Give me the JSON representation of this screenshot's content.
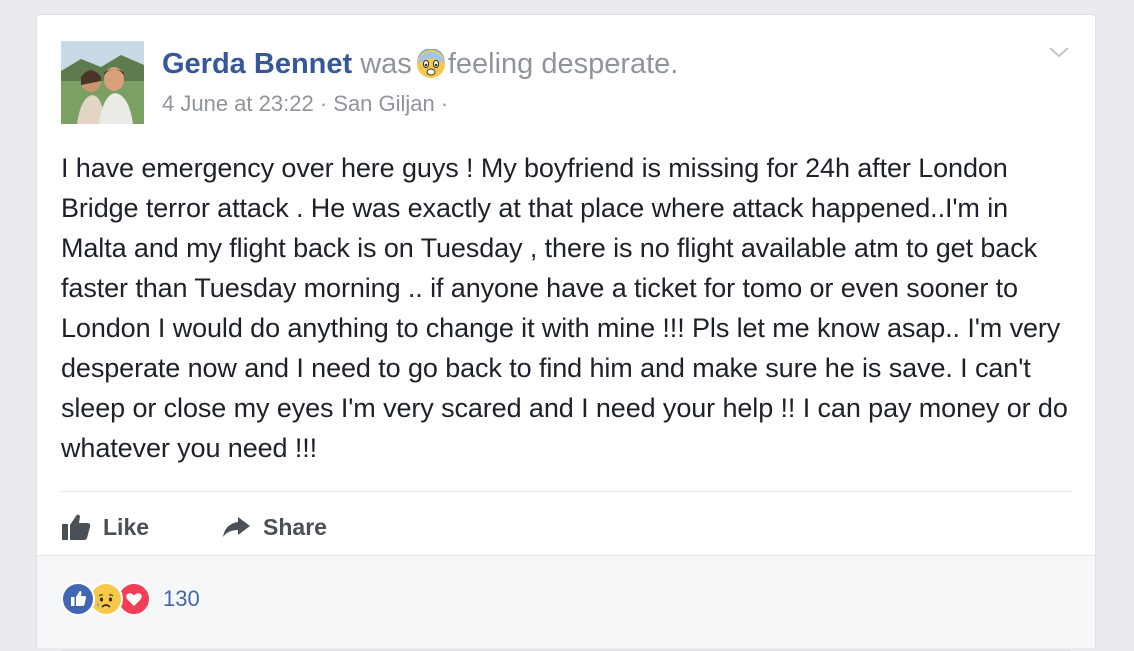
{
  "post": {
    "author": "Gerda Bennet",
    "was": "was",
    "feeling": "feeling desperate.",
    "date": "4 June at 23:22",
    "separator": "·",
    "location": "San Giljan",
    "trailing_separator": "·",
    "body": "I have emergency over here guys ! My boyfriend is missing for 24h after London Bridge terror attack . He was exactly at that place where attack happened..I'm in Malta and my flight back is on Tuesday , there is no flight available atm to get back faster than Tuesday morning .. if anyone have a ticket for tomo or even sooner to London I would do anything to change it with mine !!! Pls let me know asap.. I'm very desperate now and I need to go back to find him and make sure he is save. I can't sleep or close my eyes I'm very scared and I need your help !! I can pay money or do whatever you need !!!"
  },
  "actions": {
    "like_label": "Like",
    "share_label": "Share"
  },
  "reactions": {
    "types": [
      "like-icon",
      "sad-icon",
      "love-icon"
    ],
    "count": "130"
  },
  "colors": {
    "author": "#365899",
    "muted": "#90949c",
    "like_blue": "#4267b2",
    "love_red": "#f33e58",
    "sad_yellow": "#f7c94b"
  }
}
